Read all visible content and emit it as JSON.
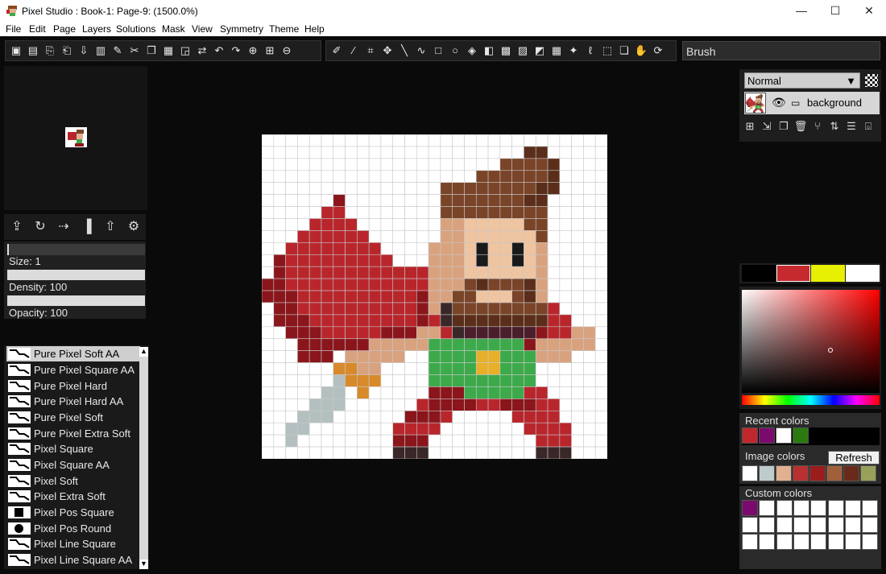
{
  "window": {
    "title": "Pixel Studio : Book-1: Page-9:  (1500.0%)",
    "minimize": "—",
    "maximize": "☐",
    "close": "✕"
  },
  "menu": [
    "File",
    "Edit",
    "Page",
    "Layers",
    "Solutions",
    "Mask",
    "View",
    "Symmetry",
    "Theme",
    "Help"
  ],
  "toolbar": {
    "file_tools": [
      "save-icon",
      "save-as-icon",
      "export-icon",
      "export-alt-icon",
      "import-icon",
      "page-icon",
      "brush-icon",
      "cut-icon",
      "copy-icon",
      "paste-icon",
      "paste-special-icon",
      "swap-icon",
      "undo-icon",
      "redo-icon",
      "zoom-in-icon",
      "zoom-fit-icon",
      "zoom-out-icon"
    ],
    "draw_tools": [
      "pencil-icon",
      "eyedropper-icon",
      "crop-icon",
      "move-icon",
      "line-icon",
      "curve-icon",
      "rectangle-icon",
      "ellipse-icon",
      "fill-icon",
      "gradient-icon",
      "pattern-icon",
      "dither-icon",
      "stamp-icon",
      "checker-tool-icon",
      "magic-wand-icon",
      "lasso-icon",
      "select-icon",
      "layer-copy-icon",
      "hand-icon",
      "rotate-icon"
    ],
    "current_tool": "Brush"
  },
  "brush": {
    "size_label": "Size: 1",
    "density_label": "Density: 100",
    "opacity_label": "Opacity: 100"
  },
  "brush_list": [
    "Pure Pixel Soft AA",
    "Pure Pixel Square AA",
    "Pure Pixel Hard",
    "Pure Pixel Hard AA",
    "Pure Pixel Soft",
    "Pure Pixel Extra Soft",
    "Pixel Square",
    "Pixel Square AA",
    "Pixel Soft",
    "Pixel Extra Soft",
    "Pixel Pos Square",
    "Pixel Pos Round",
    "Pixel Line Square",
    "Pixel Line Square AA"
  ],
  "layers": {
    "blend_mode": "Normal",
    "layer_name": "background"
  },
  "colors": {
    "palette_bar": [
      "#000000",
      "#c62a2f",
      "#e6f000",
      "#ffffff"
    ],
    "recent_title": "Recent colors",
    "recent": [
      "#c0282e",
      "#7a0a6e",
      "#ffffff",
      "#2a7a10"
    ],
    "image_title": "Image colors",
    "refresh_label": "Refresh",
    "image": [
      "#ffffff",
      "#c0cccc",
      "#e0b090",
      "#b83030",
      "#9a1c1c",
      "#a0603a",
      "#6a2a1a",
      "#98a05a"
    ],
    "custom_title": "Custom colors",
    "custom_first": "#7a0a6e"
  },
  "art": {
    "cols": 29,
    "rows": 27,
    "palette": {
      "W": "#ffffff",
      "R": "#b8262c",
      "D": "#8a161c",
      "B": "#7a4428",
      "K": "#5a2e1a",
      "S": "#d9a27e",
      "L": "#efc4a0",
      "E": "#1a1a1a",
      "G": "#3caa4a",
      "Y": "#e8b028",
      "O": "#d88a2a",
      "A": "#b4c0c0",
      "N": "#3a2828",
      "P": "#4a1e2a"
    },
    "pixels": [
      "WWWWWWWWWWWWWWWWWWWWWWWWWWWWW",
      "WWWWWWWWWWWWWWWWWWWWWWKKWWWWW",
      "WWWWWWWWWWWWWWWWWWWWBBBBKWWWW",
      "WWWWWWWWWWWWWWWWWWBBBBBBKWWWW",
      "WWWWWWWWWWWWWWWBBBBBBBBKKWWWW",
      "WWWWWWDWWWWWWWWBBBBBBBKKWWWWW",
      "WWWWWRRWWWWWWWWBBBBBBBBBWWWWW",
      "WWWWRRRRWWWWWWWSSLLLLLBBWWWWW",
      "WWWRRRRRRWWWWWWSSLLLLLLBWWWWW",
      "WWRRRRRRRRWWWWSSSLELLELSWWWWW",
      "WDRRRRRRRRRWWWSSSLELLELSWWWWW",
      "WDRRRRRRRRRRRRSSSLLLLLLSWWWWW",
      "DDRRRRRRRRRRRRSSSBKBBBKSWWWWW",
      "DDDRRRRRRRRRRDSSBBLLLBKSWWWWW",
      "WDDRRRRRRRRRRDSNBBBBBBBBRWWWW",
      "WDDDRRRRRRRRRDRNKKKKKKKKRRWWW",
      "WWDDDRRRRRDDDSSRNPPPPPPDRRSSW",
      "WWWDDDDDDSSSSSGGGGGGGGDSSSSSW",
      "WWWDDDWSSSSSWWGGGGYYGGGSSSWWW",
      "WWWWWWOOSSWWWWGGGGYYGGGWWWWWW",
      "WWWWWWAOOOWWWWGGGGGGGGGWWWWWW",
      "WWWWWAAWOWWWWWDDDGGGGGRRWWWWW",
      "WWWWAAAWWWWWWRDDDDRRDDDRRWWWW",
      "WWWAAAWWWWWWDDDRWWWWWRRRRWWWW",
      "WWAAWWWWWWWRRRRWWWWWWWRRRRWWW",
      "WWAWWWWWWWWDDDWWWWWWWWWRRRWWW",
      "WWWWWWWWWWWNNNWWWWWWWWWNNNWWW"
    ]
  }
}
